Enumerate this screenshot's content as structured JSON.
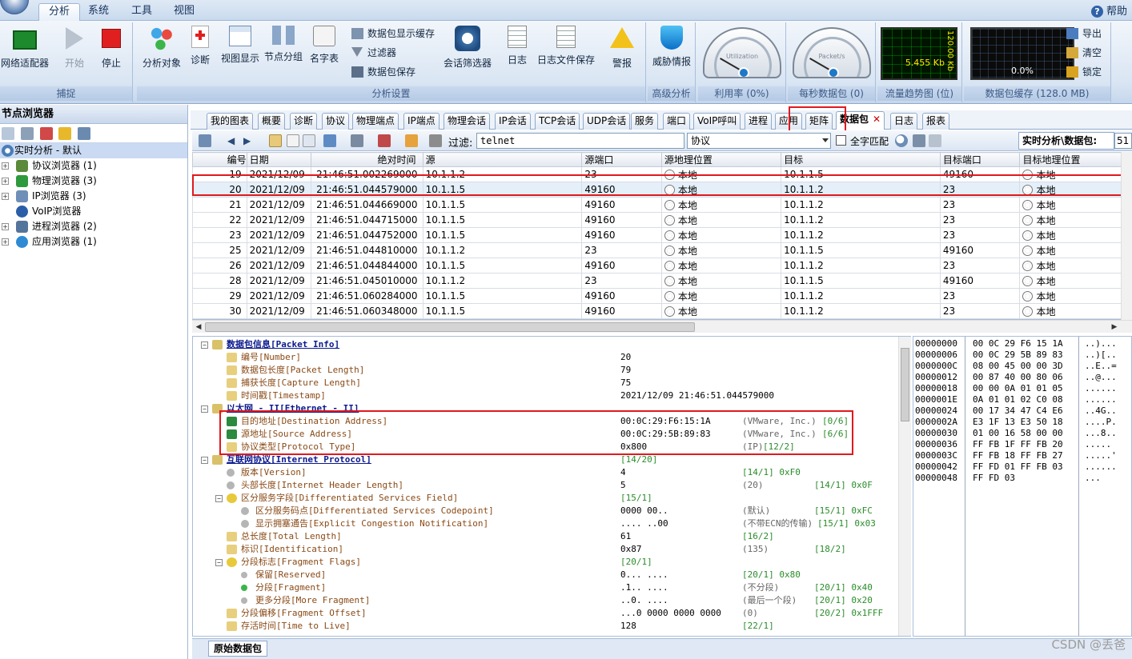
{
  "menubar": {
    "tabs": [
      "分析",
      "系统",
      "工具",
      "视图"
    ],
    "help": "帮助"
  },
  "ribbon": {
    "capture": {
      "label": "捕捉",
      "buttons": [
        "网络适配器",
        "开始",
        "停止"
      ]
    },
    "analysis_settings": {
      "label": "分析设置",
      "buttons": [
        "分析对象",
        "诊断",
        "视图显示",
        "节点分组",
        "名字表"
      ],
      "small": [
        "数据包显示缓存",
        "过滤器",
        "数据包保存"
      ],
      "buttons2": [
        "会话筛选器",
        "日志",
        "日志文件保存",
        "警报"
      ]
    },
    "advanced": {
      "label": "高级分析",
      "button": "威胁情报"
    },
    "utilization": {
      "label": "利用率 (0%)",
      "gauge_text": "Utilization"
    },
    "pps": {
      "label": "每秒数据包 (0)",
      "gauge_text": "Packet/s"
    },
    "trend": {
      "label": "流量趋势图 (位)",
      "value": "5.455 Kb",
      "vlabel": "120.00 Kb"
    },
    "cache": {
      "label": "数据包缓存 (128.0 MB)",
      "value": "0.0%",
      "buttons": [
        "导出",
        "清空",
        "锁定"
      ]
    }
  },
  "left_panel": {
    "title": "节点浏览器",
    "root": "实时分析 - 默认",
    "items": [
      {
        "label": "协议浏览器",
        "count": "(1)"
      },
      {
        "label": "物理浏览器",
        "count": "(3)"
      },
      {
        "label": "IP浏览器",
        "count": "(3)"
      },
      {
        "label": "VoIP浏览器",
        "count": ""
      },
      {
        "label": "进程浏览器",
        "count": "(2)"
      },
      {
        "label": "应用浏览器",
        "count": "(1)"
      }
    ]
  },
  "tabs": [
    "我的图表",
    "概要",
    "诊断",
    "协议",
    "物理端点",
    "IP端点",
    "物理会话",
    "IP会话",
    "TCP会话",
    "UDP会话",
    "服务",
    "端口",
    "VoIP呼叫",
    "进程",
    "应用",
    "矩阵",
    "数据包",
    "日志",
    "报表"
  ],
  "active_tab": "数据包",
  "filterbar": {
    "filter_label": "过滤:",
    "filter_value": "telnet",
    "field": "协议",
    "match_label": "全字匹配",
    "path_label": "实时分析\\数据包:",
    "path_value": "51"
  },
  "packets": {
    "columns": [
      "编号",
      "日期",
      "绝对时间",
      "源",
      "源端口",
      "源地理位置",
      "目标",
      "目标端口",
      "目标地理位置"
    ],
    "rows": [
      [
        "19",
        "2021/12/09",
        "21:46:51.002269000",
        "10.1.1.2",
        "23",
        "本地",
        "10.1.1.5",
        "49160",
        "本地"
      ],
      [
        "20",
        "2021/12/09",
        "21:46:51.044579000",
        "10.1.1.5",
        "49160",
        "本地",
        "10.1.1.2",
        "23",
        "本地"
      ],
      [
        "21",
        "2021/12/09",
        "21:46:51.044669000",
        "10.1.1.5",
        "49160",
        "本地",
        "10.1.1.2",
        "23",
        "本地"
      ],
      [
        "22",
        "2021/12/09",
        "21:46:51.044715000",
        "10.1.1.5",
        "49160",
        "本地",
        "10.1.1.2",
        "23",
        "本地"
      ],
      [
        "23",
        "2021/12/09",
        "21:46:51.044752000",
        "10.1.1.5",
        "49160",
        "本地",
        "10.1.1.2",
        "23",
        "本地"
      ],
      [
        "25",
        "2021/12/09",
        "21:46:51.044810000",
        "10.1.1.2",
        "23",
        "本地",
        "10.1.1.5",
        "49160",
        "本地"
      ],
      [
        "26",
        "2021/12/09",
        "21:46:51.044844000",
        "10.1.1.5",
        "49160",
        "本地",
        "10.1.1.2",
        "23",
        "本地"
      ],
      [
        "28",
        "2021/12/09",
        "21:46:51.045010000",
        "10.1.1.2",
        "23",
        "本地",
        "10.1.1.5",
        "49160",
        "本地"
      ],
      [
        "29",
        "2021/12/09",
        "21:46:51.060284000",
        "10.1.1.5",
        "49160",
        "本地",
        "10.1.1.2",
        "23",
        "本地"
      ],
      [
        "30",
        "2021/12/09",
        "21:46:51.060348000",
        "10.1.1.5",
        "49160",
        "本地",
        "10.1.1.2",
        "23",
        "本地"
      ]
    ]
  },
  "decode": {
    "rows": [
      {
        "t": "数据包信息[Packet Info]",
        "v": "",
        "n": "",
        "o": ""
      },
      {
        "t": "编号[Number]",
        "v": "20",
        "n": "",
        "o": ""
      },
      {
        "t": "数据包长度[Packet Length]",
        "v": "79",
        "n": "",
        "o": ""
      },
      {
        "t": "捕获长度[Capture Length]",
        "v": "75",
        "n": "",
        "o": ""
      },
      {
        "t": "时间戳[Timestamp]",
        "v": "2021/12/09 21:46:51.044579000",
        "n": "",
        "o": ""
      },
      {
        "t": "以太网 - II[Ethernet - II]",
        "v": "",
        "n": "",
        "o": ""
      },
      {
        "t": "目的地址[Destination Address]",
        "v": "00:0C:29:F6:15:1A",
        "n": "(VMware, Inc.)",
        "o": "[0/6]"
      },
      {
        "t": "源地址[Source Address]",
        "v": "00:0C:29:5B:89:83",
        "n": "(VMware, Inc.)",
        "o": "[6/6]"
      },
      {
        "t": "协议类型[Protocol Type]",
        "v": "0x800",
        "n": "(IP)",
        "o": "[12/2]"
      },
      {
        "t": "互联网协议[Internet Protocol]",
        "v": "[14/20]",
        "n": "",
        "o": ""
      },
      {
        "t": "版本[Version]",
        "v": "4",
        "n": "",
        "o": "[14/1]  0xF0"
      },
      {
        "t": "头部长度[Internet Header Length]",
        "v": "5",
        "n": "(20)",
        "o": "[14/1]  0x0F"
      },
      {
        "t": "区分服务字段[Differentiated Services Field]",
        "v": "[15/1]",
        "n": "",
        "o": ""
      },
      {
        "t": "区分服务码点[Differentiated Services Codepoint]",
        "v": "0000 00..",
        "n": "(默认)",
        "o": "[15/1]  0xFC"
      },
      {
        "t": "显示拥塞通告[Explicit Congestion Notification]",
        "v": ".... ..00",
        "n": "(不带ECN的传输)",
        "o": "[15/1]  0x03"
      },
      {
        "t": "总长度[Total Length]",
        "v": "61",
        "n": "",
        "o": "[16/2]"
      },
      {
        "t": "标识[Identification]",
        "v": "0x87",
        "n": "(135)",
        "o": "[18/2]"
      },
      {
        "t": "分段标志[Fragment Flags]",
        "v": "[20/1]",
        "n": "",
        "o": ""
      },
      {
        "t": "保留[Reserved]",
        "v": "0... ....",
        "n": "",
        "o": "[20/1]  0x80"
      },
      {
        "t": "分段[Fragment]",
        "v": ".1.. ....",
        "n": "(不分段)",
        "o": "[20/1]  0x40"
      },
      {
        "t": "更多分段[More Fragment]",
        "v": "..0. ....",
        "n": "(最后一个段)",
        "o": "[20/1]  0x20"
      },
      {
        "t": "分段偏移[Fragment Offset]",
        "v": "...0 0000 0000 0000",
        "n": "(0)",
        "o": "[20/2]  0x1FFF"
      },
      {
        "t": "存活时间[Time to Live]",
        "v": "128",
        "n": "",
        "o": "[22/1]"
      }
    ]
  },
  "hex": {
    "rows": [
      [
        "00000000",
        "00 0C 29 F6 15 1A",
        "..)..."
      ],
      [
        "00000006",
        "00 0C 29 5B 89 83",
        "..)[.."
      ],
      [
        "0000000C",
        "08 00 45 00 00 3D",
        "..E..="
      ],
      [
        "00000012",
        "00 87 40 00 80 06",
        "..@..."
      ],
      [
        "00000018",
        "00 00 0A 01 01 05",
        "......"
      ],
      [
        "0000001E",
        "0A 01 01 02 C0 08",
        "......"
      ],
      [
        "00000024",
        "00 17 34 47 C4 E6",
        "..4G.."
      ],
      [
        "0000002A",
        "E3 1F 13 E3 50 18",
        "....P."
      ],
      [
        "00000030",
        "01 00 16 58 00 00",
        "...8.."
      ],
      [
        "00000036",
        "FF FB 1F FF FB 20",
        "....."
      ],
      [
        "0000003C",
        "FF FB 18 FF FB 27",
        ".....'"
      ],
      [
        "00000042",
        "FF FD 01 FF FB 03",
        "......"
      ],
      [
        "00000048",
        "FF FD 03",
        "..."
      ]
    ]
  },
  "bottom_tab": "原始数据包",
  "watermark": "CSDN @丢爸"
}
